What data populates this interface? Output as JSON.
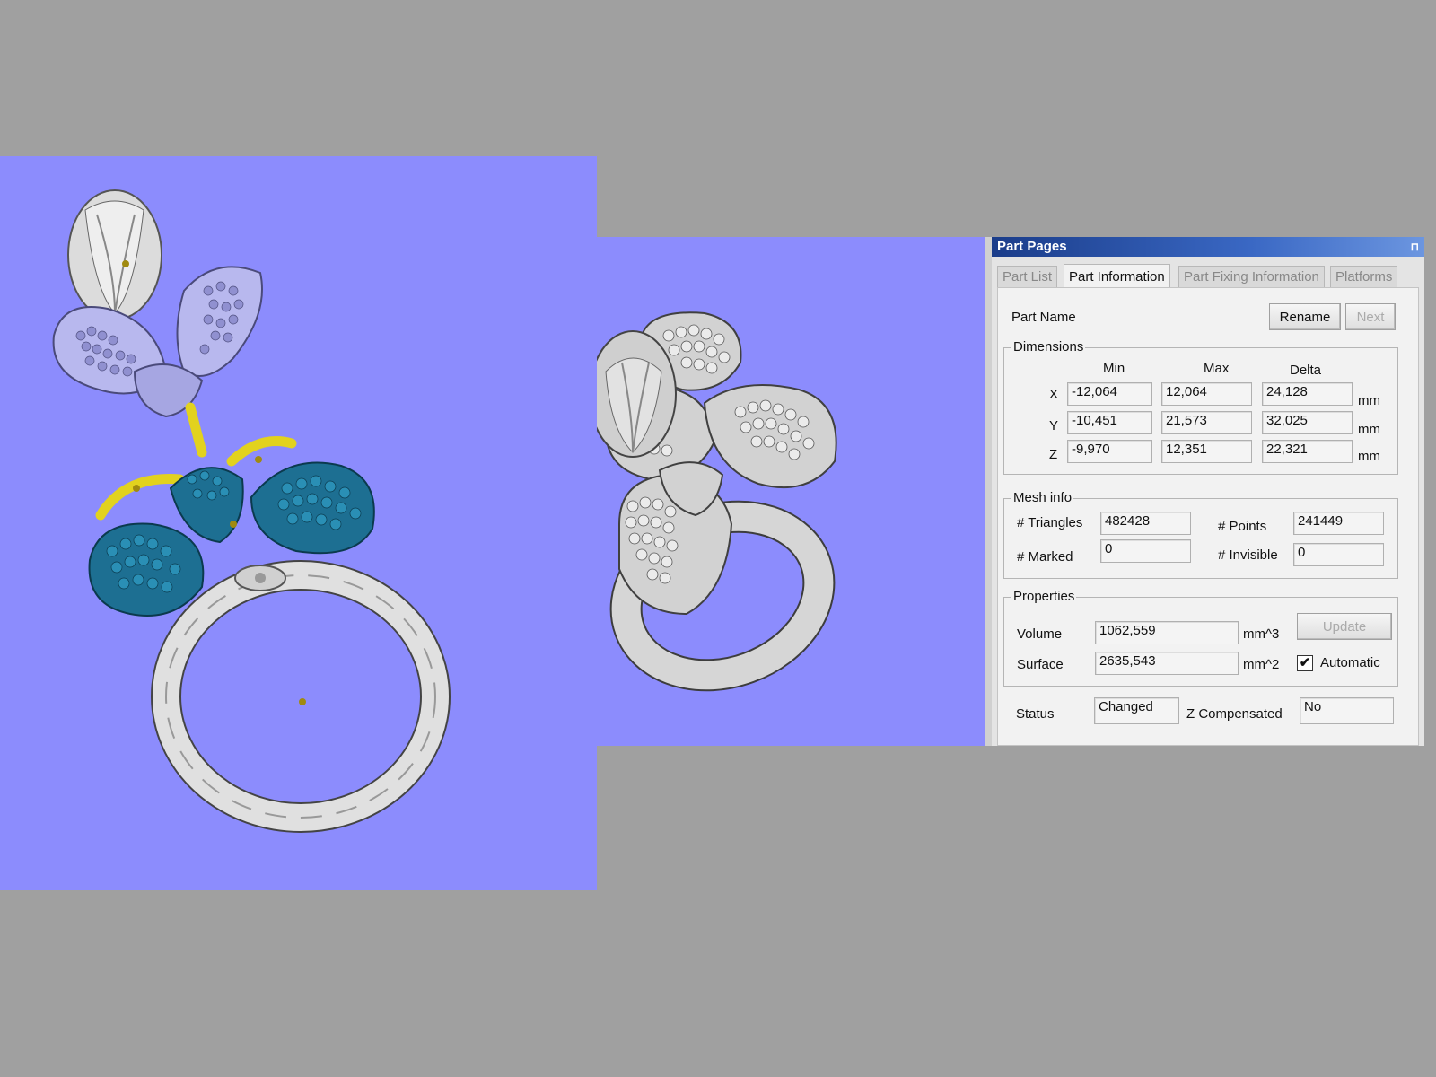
{
  "panel": {
    "title": "Part Pages",
    "tabs": [
      {
        "label": "Part List",
        "active": false
      },
      {
        "label": "Part Information",
        "active": true
      },
      {
        "label": "Part Fixing Information",
        "active": false
      },
      {
        "label": "Platforms",
        "active": false
      }
    ],
    "part_name_label": "Part Name",
    "rename_button": "Rename",
    "next_button": "Next",
    "dimensions": {
      "legend": "Dimensions",
      "col_min": "Min",
      "col_max": "Max",
      "col_delta": "Delta",
      "rows": [
        {
          "axis": "X",
          "min": "-12,064",
          "max": "12,064",
          "delta": "24,128",
          "unit": "mm"
        },
        {
          "axis": "Y",
          "min": "-10,451",
          "max": "21,573",
          "delta": "32,025",
          "unit": "mm"
        },
        {
          "axis": "Z",
          "min": "-9,970",
          "max": "12,351",
          "delta": "22,321",
          "unit": "mm"
        }
      ]
    },
    "mesh": {
      "legend": "Mesh info",
      "triangles_label": "# Triangles",
      "triangles": "482428",
      "points_label": "# Points",
      "points": "241449",
      "marked_label": "# Marked",
      "marked": "0",
      "invisible_label": "# Invisible",
      "invisible": "0"
    },
    "properties": {
      "legend": "Properties",
      "volume_label": "Volume",
      "volume": "1062,559",
      "volume_unit": "mm^3",
      "surface_label": "Surface",
      "surface": "2635,543",
      "surface_unit": "mm^2",
      "update_button": "Update",
      "automatic_label": "Automatic",
      "automatic_checked": "✔"
    },
    "status_label": "Status",
    "status": "Changed",
    "zcomp_label": "Z Compensated",
    "zcomp": "No"
  },
  "colors": {
    "viewport_bg": "#8c8cfd",
    "desktop_bg": "#a0a0a0",
    "part_teal": "#1a6a8c",
    "part_lavender": "#b4b4f0",
    "part_yellow": "#e0d020",
    "part_silver": "#d8d8d8"
  }
}
